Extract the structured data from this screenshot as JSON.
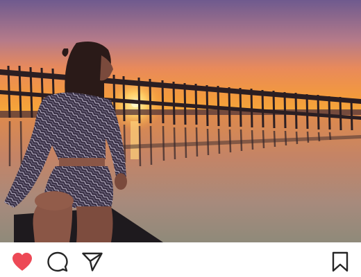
{
  "post": {
    "like_state": "liked",
    "like_icon": "heart-filled-icon",
    "comment_icon": "speech-bubble-icon",
    "share_icon": "paper-plane-icon",
    "save_icon": "bookmark-icon"
  },
  "colors": {
    "like_red": "#ed4956",
    "icon_stroke": "#262626",
    "sky_top": "#6f5a8e",
    "sky_horizon": "#f39a3c",
    "water": "#a58a7a"
  }
}
